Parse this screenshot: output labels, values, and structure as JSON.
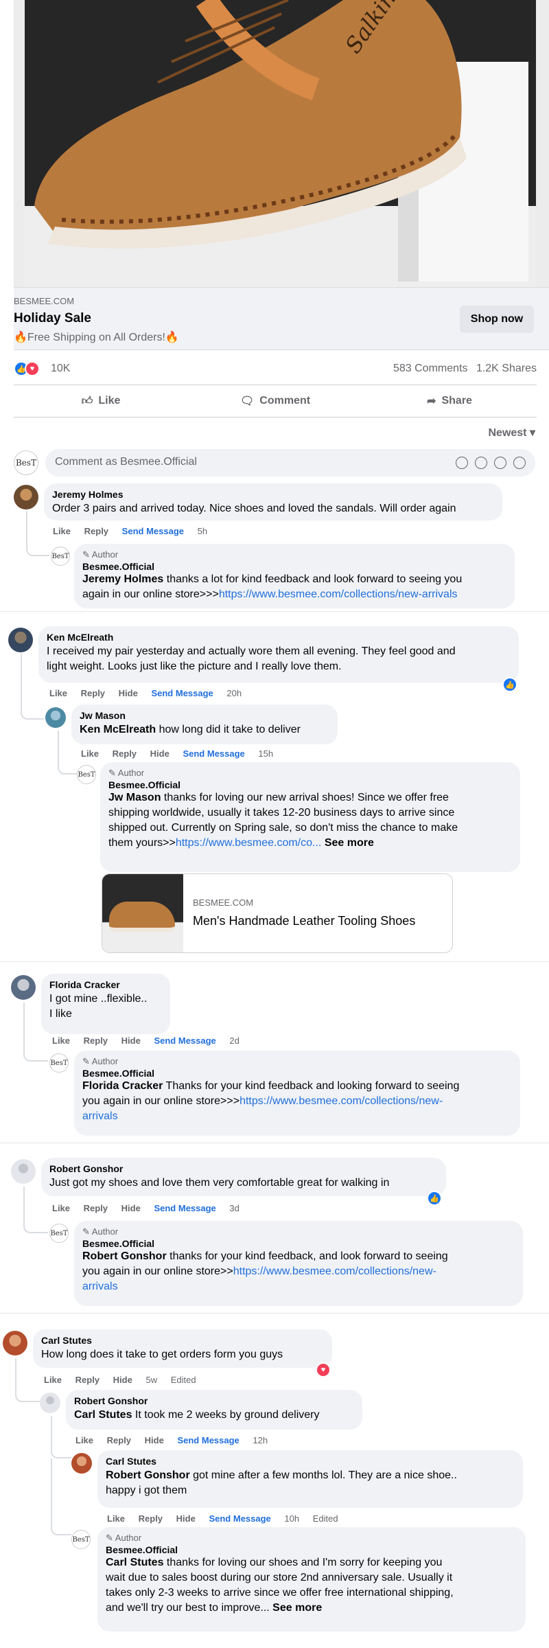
{
  "post": {
    "link_domain": "BESMEE.COM",
    "link_title": "Holiday Sale",
    "link_description": "🔥Free Shipping on All Orders!🔥",
    "shop_button": "Shop now",
    "brand_text": "Salkin",
    "reaction_count": "10K",
    "comments_count": "583 Comments",
    "shares_count": "1.2K Shares",
    "actions": {
      "like": "Like",
      "comment": "Comment",
      "share": "Share"
    },
    "sort_label": "Newest",
    "write_placeholder": "Comment as Besmee.Official",
    "avatar_text": "BesT"
  },
  "labels": {
    "like": "Like",
    "reply": "Reply",
    "hide": "Hide",
    "send_message": "Send Message",
    "author": "Author",
    "edited": "Edited",
    "see_more": "See more"
  },
  "comments": [
    {
      "name": "Jeremy Holmes",
      "text": "Order 3 pairs and arrived today. Nice shoes and loved the sandals. Will order again",
      "time": "5h",
      "reply": {
        "name": "Besmee.Official",
        "mention": "Jeremy Holmes",
        "text_line1": " thanks a lot for kind feedback and look forward to seeing you",
        "text_line2": "again in our online store>>>",
        "link": "https://www.besmee.com/collections/new-arrivals"
      }
    },
    {
      "name": "Ken McElreath",
      "text_line1": "I received my pair yesterday and actually wore them all evening. They feel good and",
      "text_line2": "light weight. Looks just like the picture and I really love them.",
      "time": "20h",
      "reply1": {
        "name": "Jw Mason",
        "mention": "Ken McElreath",
        "text": " how long did it take to deliver",
        "time": "15h"
      },
      "reply2": {
        "name": "Besmee.Official",
        "mention": "Jw Mason",
        "text_line1": " thanks for loving our new arrival shoes! Since we offer free",
        "text_line2": "shipping worldwide, usually it takes 12-20 business days to arrive since",
        "text_line3": "shipped out. Currently on Spring sale, so don't miss the chance to make",
        "text_line4": "them yours>>",
        "link": "https://www.besmee.com/co...",
        "card_domain": "BESMEE.COM",
        "card_title": "Men's Handmade Leather Tooling Shoes"
      }
    },
    {
      "name": "Florida Cracker",
      "text_line1": "I got mine ..flexible..",
      "text_line2": "I like",
      "time": "2d",
      "reply": {
        "name": "Besmee.Official",
        "mention": "Florida Cracker",
        "text_line1": " Thanks for your kind feedback and looking forward to seeing",
        "text_line2": "you again in our online store>>>",
        "link1": "https://www.besmee.com/collections/new-",
        "link2": "arrivals"
      }
    },
    {
      "name": "Robert Gonshor",
      "text": "Just got my shoes and love them very comfortable great for walking in",
      "time": "3d",
      "reply": {
        "name": "Besmee.Official",
        "mention": "Robert Gonshor",
        "text_line1": " thanks for your kind feedback, and look forward to seeing",
        "text_line2": "you again in our online store>>",
        "link1": "https://www.besmee.com/collections/new-",
        "link2": "arrivals"
      }
    },
    {
      "name": "Carl Stutes",
      "text": "How long does it take to get orders form you guys",
      "time": "5w",
      "reply1": {
        "name": "Robert Gonshor",
        "mention": "Carl Stutes",
        "text": " It took me 2 weeks by ground delivery",
        "time": "12h"
      },
      "reply2": {
        "name": "Carl Stutes",
        "mention": "Robert Gonshor",
        "text_line1": " got mine after a few months lol. They are a nice shoe..",
        "text_line2": "happy i got them",
        "time": "10h"
      },
      "reply3": {
        "name": "Besmee.Official",
        "mention": "Carl Stutes",
        "text_line1": " thanks for loving our shoes and I'm sorry for keeping you",
        "text_line2": "wait due to sales boost during our store 2nd anniversary sale. Usually it",
        "text_line3": "takes only 2-3 weeks to arrive since we offer free international shipping,",
        "text_line4": "and we'll try our best to improve..."
      }
    }
  ]
}
